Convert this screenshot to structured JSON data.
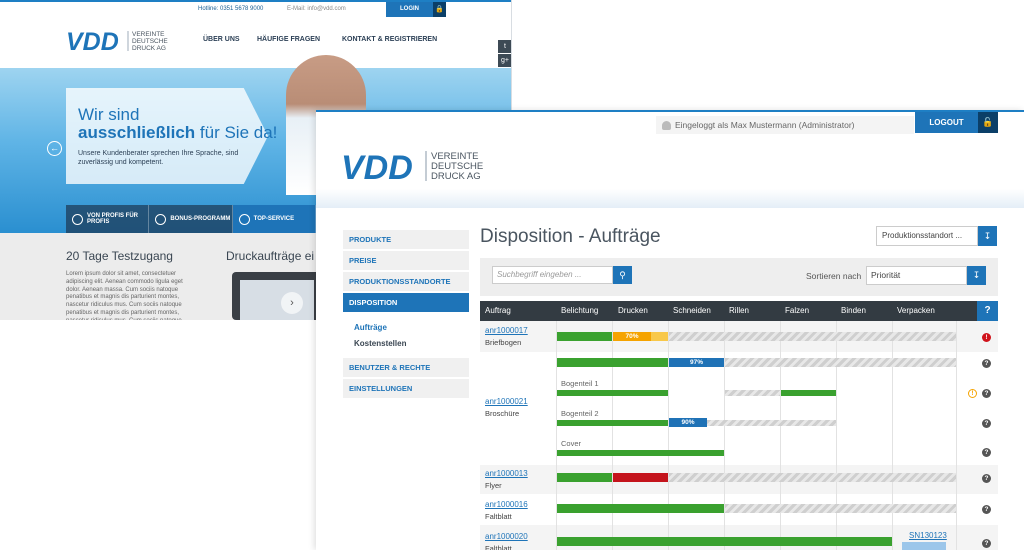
{
  "site": {
    "hotline": "Hotline: 0351 5678 9000",
    "email": "E-Mail: info@vdd.com",
    "login": "LOGIN",
    "logo": {
      "mark": "VDD",
      "line1": "VEREINTE",
      "line2": "DEUTSCHE",
      "line3": "DRUCK AG"
    },
    "nav": [
      "ÜBER UNS",
      "HÄUFIGE FRAGEN",
      "KONTAKT & REGISTRIEREN"
    ],
    "social": [
      "twitter-icon",
      "googleplus-icon",
      "facebook-icon"
    ],
    "hero": {
      "line1": "Wir sind",
      "line2_bold": "ausschließlich",
      "line2_rest": "für Sie da!",
      "sub": "Unsere Kundenberater sprechen Ihre Sprache, sind zuverlässig und kompetent."
    },
    "tabs": [
      {
        "label": "VON PROFIS FÜR PROFIS",
        "icon": "compass-icon"
      },
      {
        "label": "BONUS-PROGRAMM",
        "icon": "coins-icon"
      },
      {
        "label": "TOP-SERVICE",
        "icon": "service-icon"
      }
    ],
    "trial_title": "20 Tage Testzugang",
    "trial_text": "Lorem ipsum dolor sit amet, consectetuer adipiscing elit. Aenean commodo ligula eget dolor. Aenean massa. Cum sociis natoque penatibus et magnis dis parturient montes, nascetur ridiculus mus. Cum sociis natoque penatibus et magnis dis parturient montes, nascetur ridiculus mus. Cum sociis natoque penatibus et magnis dis parturient montes,",
    "orders_title": "Druckaufträge ei"
  },
  "admin": {
    "logged_in": "Eingeloggt als Max Mustermann (Administrator)",
    "logout": "LOGOUT",
    "logo": {
      "mark": "VDD",
      "line1": "VEREINTE",
      "line2": "DEUTSCHE",
      "line3": "DRUCK AG"
    },
    "sidebar": [
      {
        "label": "PRODUKTE",
        "active": false
      },
      {
        "label": "PREISE",
        "active": false
      },
      {
        "label": "PRODUKTIONSSTANDORTE",
        "active": false
      },
      {
        "label": "DISPOSITION",
        "active": true
      }
    ],
    "sidebar_sub": [
      "Aufträge",
      "Kostenstellen"
    ],
    "sidebar_bottom": [
      "BENUTZER & RECHTE",
      "EINSTELLUNGEN"
    ],
    "page_title": "Disposition - Aufträge",
    "location_select": "Produktionsstandort ...",
    "search_placeholder": "Suchbegriff eingeben ...",
    "sort_label": "Sortieren nach",
    "sort_value": "Priorität",
    "columns": [
      "Auftrag",
      "Belichtung",
      "Drucken",
      "Schneiden",
      "Rillen",
      "Falzen",
      "Binden",
      "Verpacken"
    ],
    "help": "?",
    "orders": [
      {
        "id": "anr1000017",
        "type": "Briefbogen"
      },
      {
        "id": "anr1000021",
        "type": "Broschüre",
        "parts": [
          "Bogenteil 1",
          "Bogenteil 2",
          "Cover"
        ]
      },
      {
        "id": "anr1000013",
        "type": "Flyer"
      },
      {
        "id": "anr1000016",
        "type": "Faltblatt"
      },
      {
        "id": "anr1000020",
        "type": "Faltblatt",
        "shipment": "SN130123"
      }
    ],
    "progress": [
      "70%",
      "97%",
      "90%"
    ],
    "colors": {
      "accent": "#1e74b8",
      "done": "#3aa12f",
      "warning": "#f5a300",
      "error": "#c4141c",
      "header": "#333b42"
    }
  }
}
